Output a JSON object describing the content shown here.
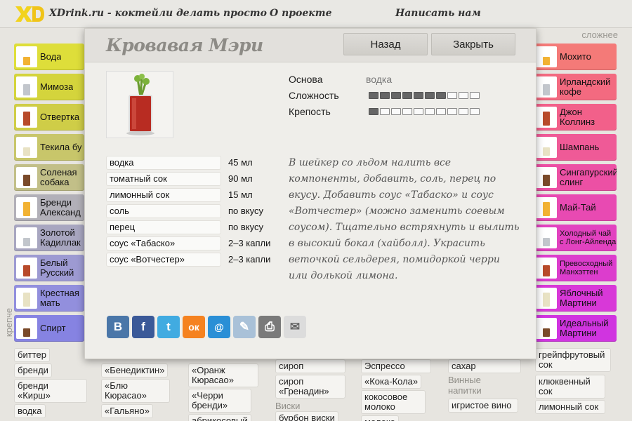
{
  "site": {
    "title": "XDrink.ru - коктейли делать просто",
    "nav": [
      "О проекте",
      "Написать нам"
    ],
    "hint_harder": "сложнее",
    "hint_stronger": "крепче"
  },
  "left_tiles": [
    {
      "label": "Вода",
      "color": "#dede3a"
    },
    {
      "label": "Мимоза",
      "color": "#d4d43c"
    },
    {
      "label": "Отвертка",
      "color": "#cfcd47"
    },
    {
      "label": "Текила бу",
      "color": "#c8c66a"
    },
    {
      "label": "Соленая собака",
      "color": "#c2bf88"
    },
    {
      "label": "Бренди Александ",
      "color": "#b2b0b8"
    },
    {
      "label": "Золотой Кадиллак",
      "color": "#a8a6c0"
    },
    {
      "label": "Белый Русский",
      "color": "#9d9ad2"
    },
    {
      "label": "Крестная мать",
      "color": "#928fdd"
    },
    {
      "label": "Спирт",
      "color": "#8683e2"
    }
  ],
  "right_tiles": [
    {
      "label": "Мохито",
      "color": "#f47a78"
    },
    {
      "label": "Ирландский кофе",
      "color": "#f36a80"
    },
    {
      "label": "Джон Коллинз",
      "color": "#f2608a"
    },
    {
      "label": "Шампань",
      "color": "#ef5a97"
    },
    {
      "label": "Сингапурский слинг",
      "color": "#ec50a4"
    },
    {
      "label": "Май-Тай",
      "color": "#e84ab2"
    },
    {
      "label": "Холодный чай с Лонг-Айленда",
      "color": "#e242c0"
    },
    {
      "label": "Превосходный Манхэттен",
      "color": "#dc3dcd"
    },
    {
      "label": "Яблочный Мартини",
      "color": "#d838d8"
    },
    {
      "label": "Идеальный Мартини",
      "color": "#d034e0"
    }
  ],
  "background_chips": {
    "col1": [
      "биттер",
      "бренди",
      "бренди «Кирш»",
      "водка"
    ],
    "col2": [
      "«Бенедиктин»",
      "«Блю Кюрасао»",
      "«Гальяно»"
    ],
    "col3": [
      "«Оранж Кюрасао»",
      "«Черри бренди»",
      "абрикосовый"
    ],
    "col4": [
      "сироп",
      "сироп «Гренадин»",
      "бурбон виски"
    ],
    "col4_category": "Виски",
    "col5": [
      "Эспрессо",
      "«Кока-Кола»",
      "кокосовое молоко",
      "молоко"
    ],
    "col6": [
      "сахар",
      "игристое вино"
    ],
    "col6_category": "Винные напитки",
    "col7": [
      "грейпфрутовый сок",
      "клюквенный сок",
      "лимонный сок"
    ]
  },
  "modal": {
    "title": "Кровавая Мэри",
    "back_label": "Назад",
    "close_label": "Закрыть",
    "base_label": "Основа",
    "base_value": "водка",
    "difficulty_label": "Сложность",
    "difficulty_level": 7,
    "strength_label": "Крепость",
    "strength_level": 1,
    "meter_segments": 10,
    "ingredients": [
      {
        "name": "водка",
        "amount": "45 мл"
      },
      {
        "name": "томатный сок",
        "amount": "90 мл"
      },
      {
        "name": "лимонный сок",
        "amount": "15 мл"
      },
      {
        "name": "соль",
        "amount": "по вкусу"
      },
      {
        "name": "перец",
        "amount": "по вкусу"
      },
      {
        "name": "соус «Табаско»",
        "amount": "2–3 капли"
      },
      {
        "name": "соус «Вотчестер»",
        "amount": "2–3 капли"
      }
    ],
    "instructions": "В шейкер со льдом налить все компоненты, добавить, соль, перец по вкусу. Добавить соус «Табаско» и соус «Вотчестер» (можно заменить соевым соусом). Тщательно встряхнуть и вылить в высокий бокал (хайболл). Украсить веточкой сельдерея, помидоркой черри или долькой лимона.",
    "share": [
      {
        "name": "vkontakte-icon",
        "glyph": "B",
        "color": "#4a76a8"
      },
      {
        "name": "facebook-icon",
        "glyph": "f",
        "color": "#3b5998"
      },
      {
        "name": "twitter-icon",
        "glyph": "t",
        "color": "#41abe1"
      },
      {
        "name": "odnoklassniki-icon",
        "glyph": "ок",
        "color": "#f58220"
      },
      {
        "name": "mail-agent-icon",
        "glyph": "@",
        "color": "#2a8fd6"
      },
      {
        "name": "livejournal-icon",
        "glyph": "✎",
        "color": "#a9c1d8"
      },
      {
        "name": "print-icon",
        "glyph": "⎙",
        "color": "#7a7a7a"
      },
      {
        "name": "email-icon",
        "glyph": "✉",
        "color": "#dcdcdc"
      }
    ]
  }
}
